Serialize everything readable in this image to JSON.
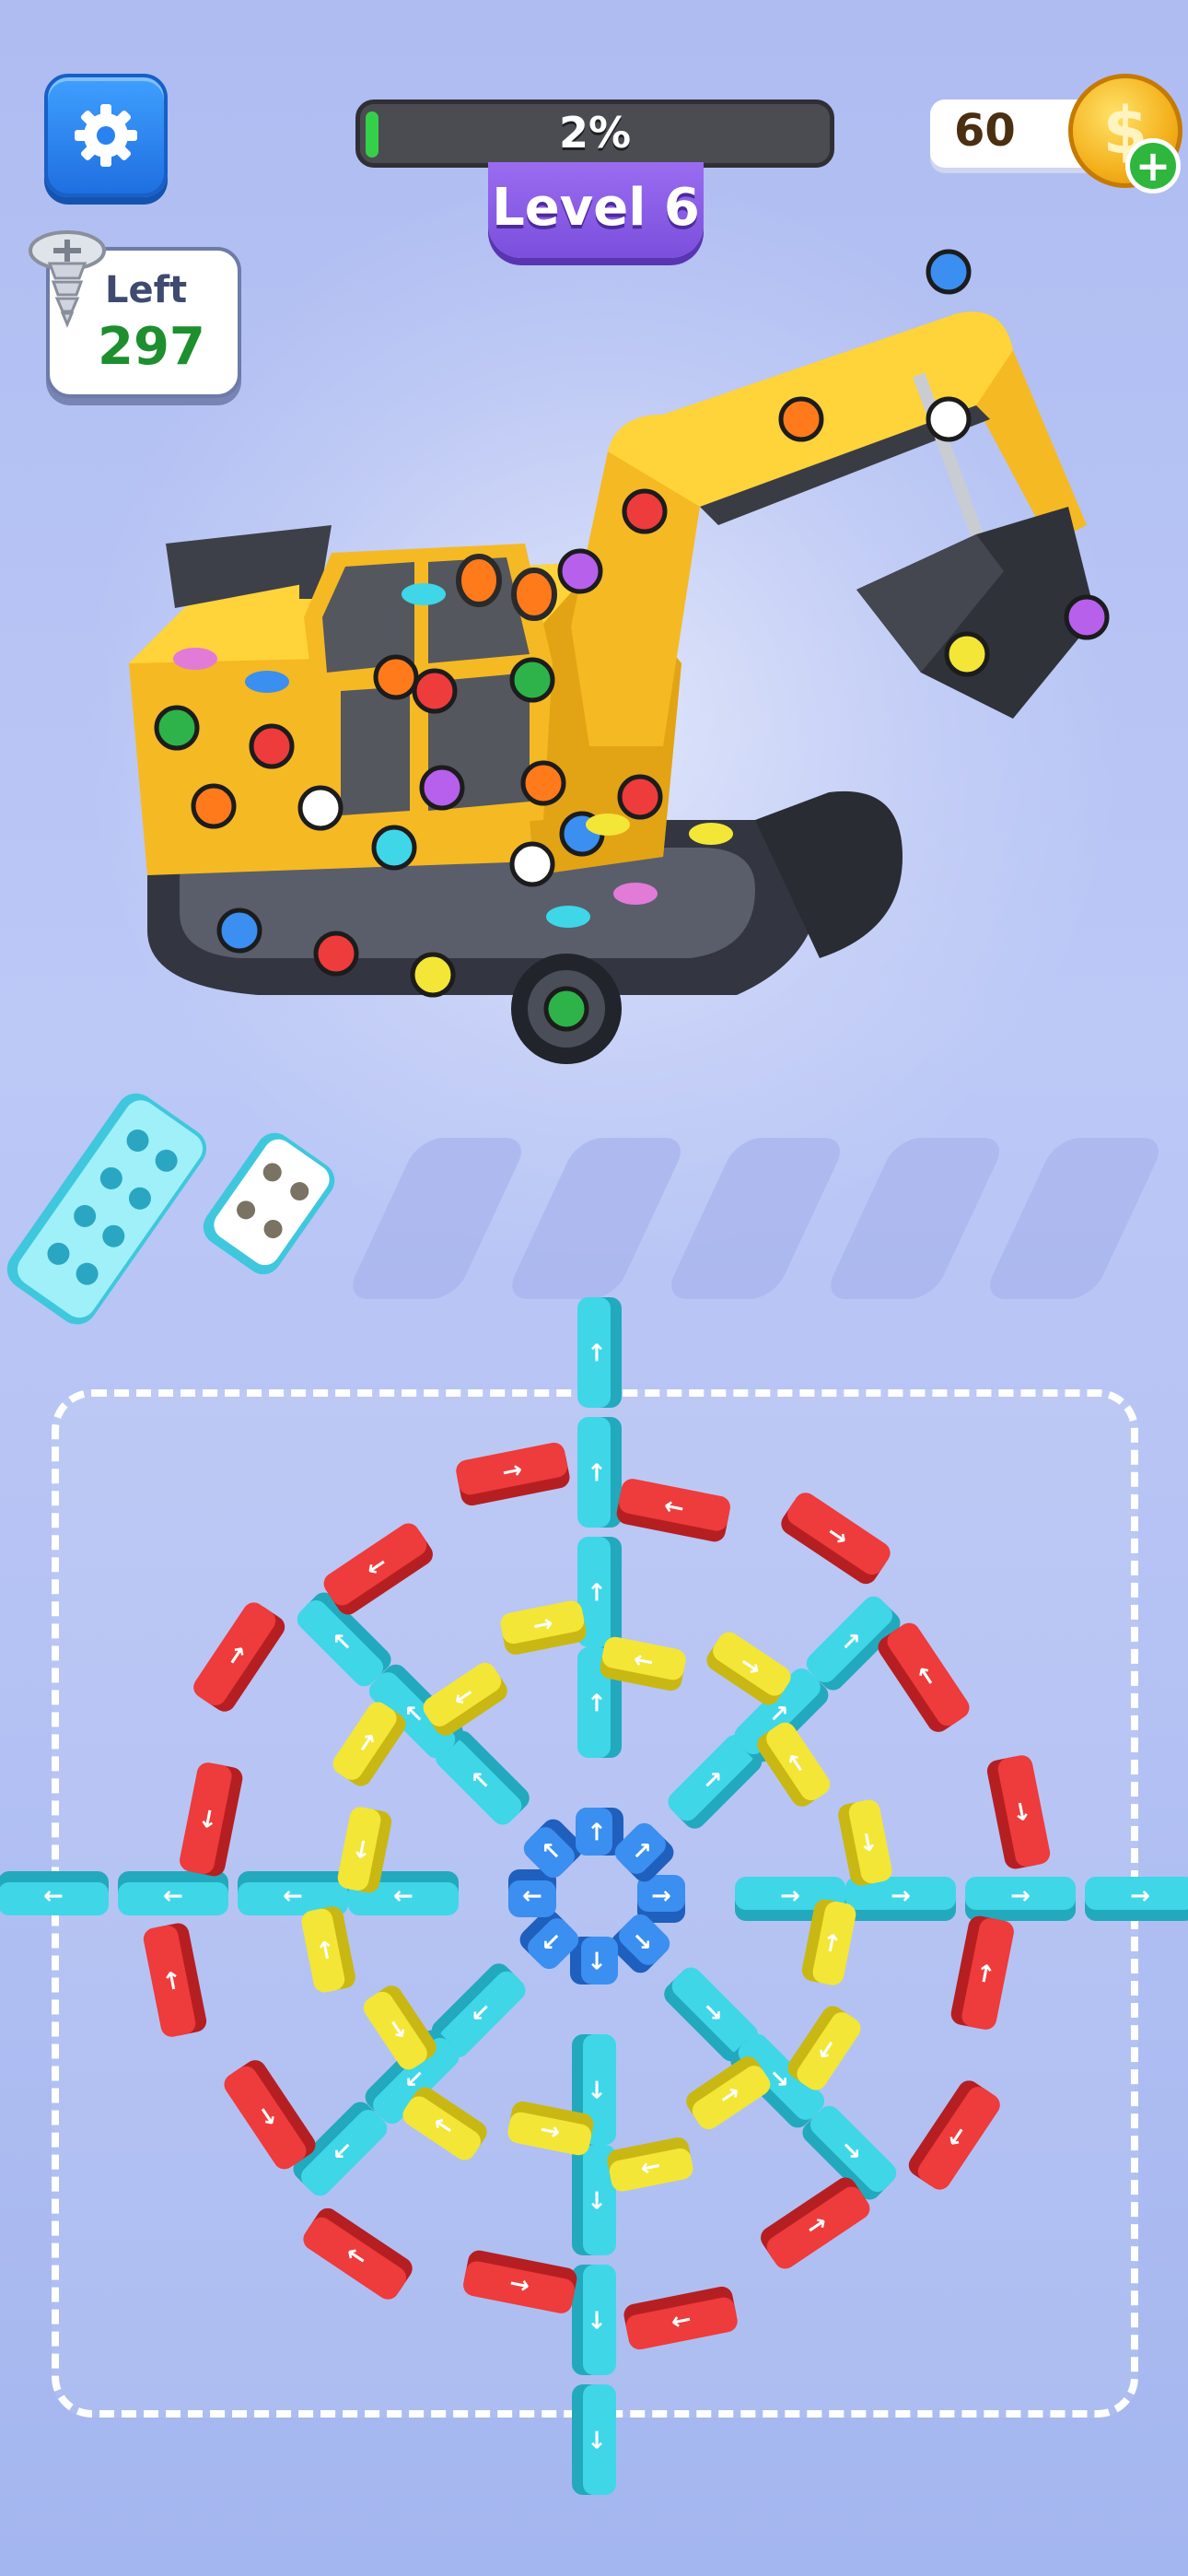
{
  "hud": {
    "progress_text": "2%",
    "progress_fraction": 0.02,
    "level_label": "Level 6",
    "coins": "60",
    "coin_symbol": "$",
    "coin_add": "+",
    "screws_left_label": "Left",
    "screws_left_count": "297"
  },
  "icons": {
    "settings": "gear-icon",
    "coin": "coin-icon",
    "add": "plus-icon",
    "screw": "screw-icon"
  },
  "colors": {
    "accent_blue": "#2a82f0",
    "level_purple": "#8a5ce8",
    "progress_green": "#35d04a",
    "block_cyan": "#3fd6e8",
    "block_red": "#ee3b3b",
    "block_yellow": "#f3e637",
    "block_purple": "#b760ec",
    "block_blue": "#3a8ff0"
  },
  "trays": {
    "filled": 2,
    "empty": 5
  }
}
